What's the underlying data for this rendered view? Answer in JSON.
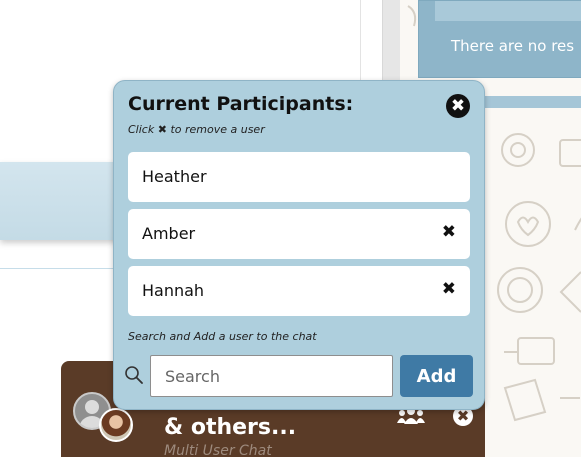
{
  "results_card": {
    "message": "There are no res"
  },
  "popup": {
    "title": "Current Participants:",
    "hint_prefix": "Click",
    "hint_x": "✖",
    "hint_suffix": "to remove a user",
    "close_symbol": "✖",
    "participants": [
      {
        "name": "Heather",
        "removable": false
      },
      {
        "name": "Amber",
        "removable": true,
        "remove_symbol": "✖"
      },
      {
        "name": "Hannah",
        "removable": true,
        "remove_symbol": "✖"
      }
    ],
    "search_caption": "Search and Add a user to the chat",
    "search_placeholder": "Search",
    "add_label": "Add"
  },
  "chat_tab": {
    "title": "& others...",
    "subtitle": "Multi User Chat",
    "close_symbol": "✖"
  },
  "colors": {
    "popup_bg": "#aecfdd",
    "add_button": "#3f7aa5",
    "chat_tab_bg": "#5a3b27"
  }
}
